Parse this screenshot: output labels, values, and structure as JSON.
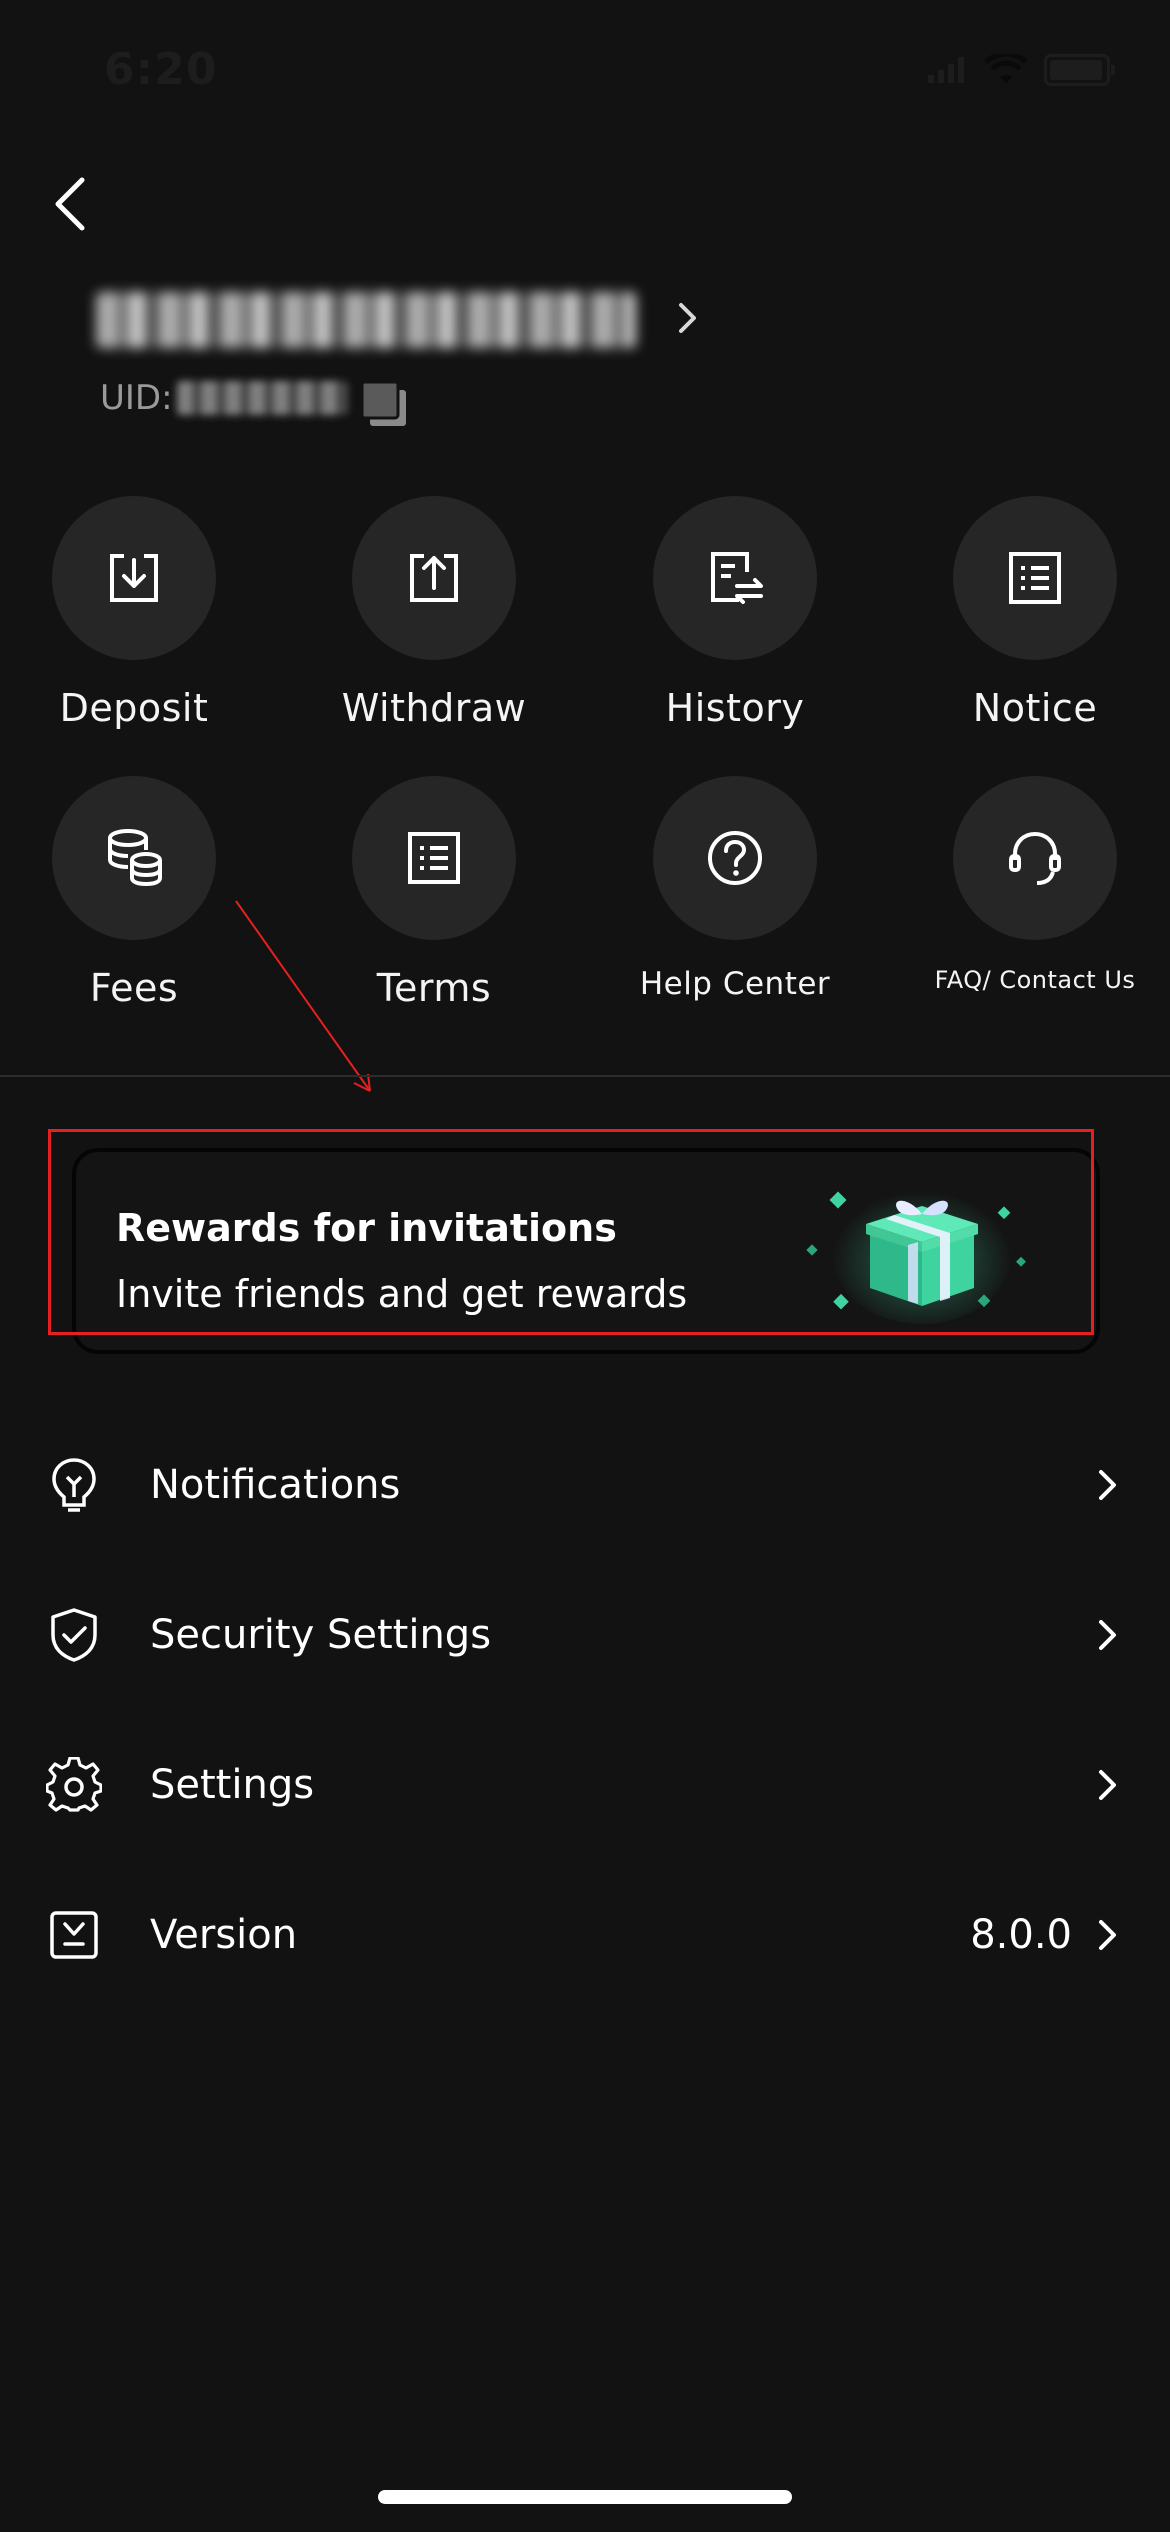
{
  "status_bar": {
    "time": "6:20"
  },
  "account": {
    "uid_label": "UID:"
  },
  "actions": [
    {
      "label": "Deposit",
      "icon": "deposit-icon"
    },
    {
      "label": "Withdraw",
      "icon": "withdraw-icon"
    },
    {
      "label": "History",
      "icon": "history-icon"
    },
    {
      "label": "Notice",
      "icon": "notice-icon"
    },
    {
      "label": "Fees",
      "icon": "coins-icon"
    },
    {
      "label": "Terms",
      "icon": "terms-icon"
    },
    {
      "label": "Help Center",
      "icon": "help-icon"
    },
    {
      "label": "FAQ/ Contact Us",
      "icon": "headset-icon"
    }
  ],
  "rewards_banner": {
    "title": "Rewards for invitations",
    "subtitle": "Invite friends and get rewards",
    "accent_color": "#3fd3a0",
    "highlight_color": "#e52020"
  },
  "menu": [
    {
      "label": "Notifications",
      "icon": "lightbulb-icon"
    },
    {
      "label": "Security Settings",
      "icon": "shield-check-icon"
    },
    {
      "label": "Settings",
      "icon": "gear-icon"
    },
    {
      "label": "Version",
      "icon": "version-icon",
      "value": "8.0.0"
    }
  ]
}
